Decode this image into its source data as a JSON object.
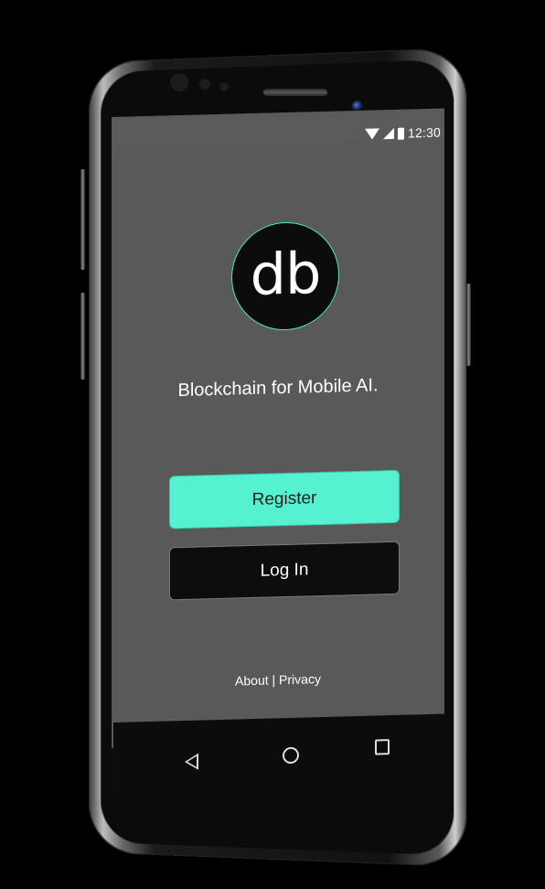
{
  "status_bar": {
    "time": "12:30",
    "icons": [
      "wifi-icon",
      "signal-icon",
      "battery-icon"
    ]
  },
  "logo": {
    "text": "db",
    "ring_color": "#4fe3c3"
  },
  "tagline": "Blockchain for Mobile AI.",
  "buttons": {
    "register_label": "Register",
    "login_label": "Log In"
  },
  "footer": {
    "about": "About",
    "separator": "|",
    "privacy": "Privacy"
  },
  "navigation": {
    "icons": [
      "back-icon",
      "home-icon",
      "recents-icon"
    ]
  },
  "colors": {
    "accent": "#55f1d0",
    "screen_background": "#595959",
    "button_dark": "#0d0d0d"
  }
}
